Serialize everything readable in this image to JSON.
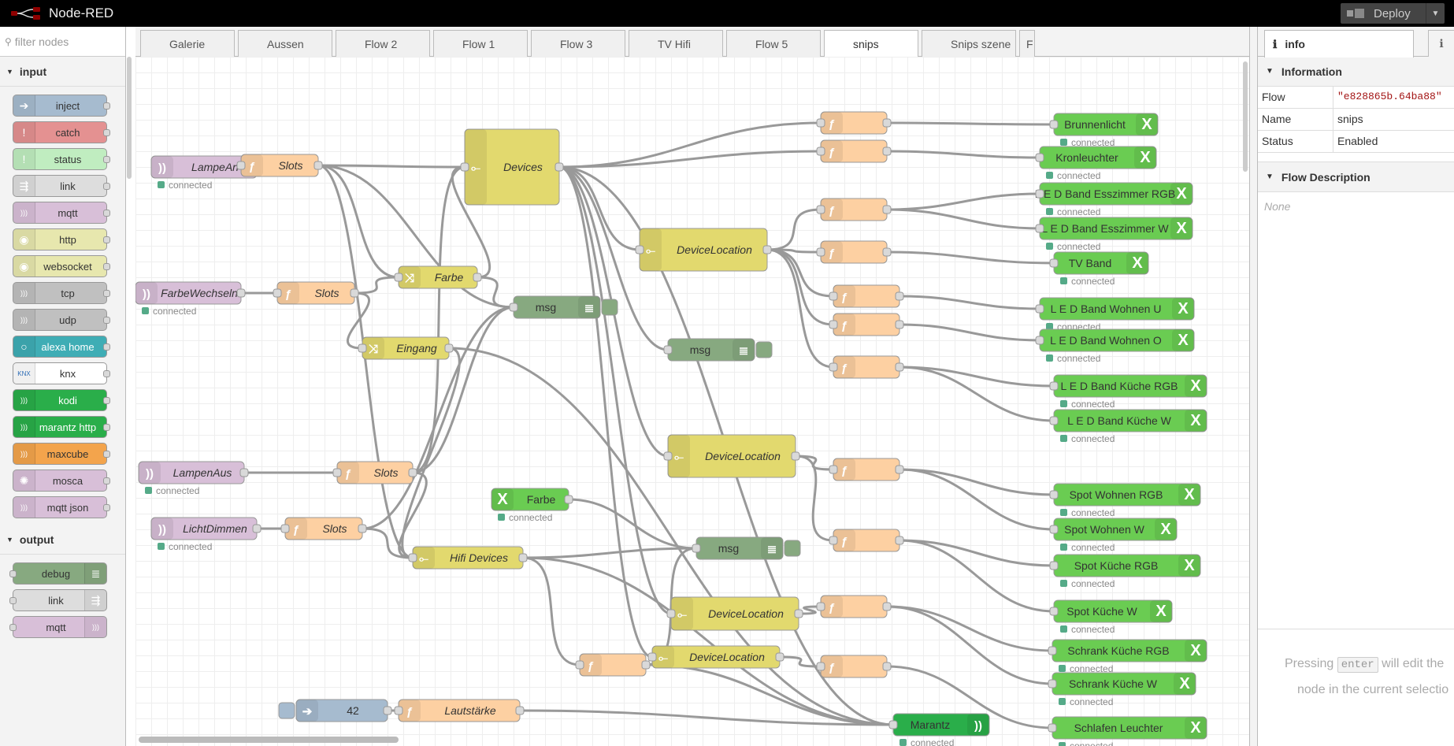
{
  "header": {
    "title": "Node-RED",
    "deploy_label": "Deploy"
  },
  "palette": {
    "search_placeholder": "filter nodes",
    "categories": [
      {
        "label": "input",
        "nodes": [
          {
            "label": "inject",
            "color": "#a6bbcf",
            "icon": "arrow-right-icon"
          },
          {
            "label": "catch",
            "color": "#e49191",
            "icon": "exclamation-icon"
          },
          {
            "label": "status",
            "color": "#c0edc0",
            "icon": "exclamation-icon"
          },
          {
            "label": "link",
            "color": "#dddddd",
            "icon": "link-icon"
          },
          {
            "label": "mqtt",
            "color": "#d8bfd8",
            "icon": "bridge-icon"
          },
          {
            "label": "http",
            "color": "#e7e7ae",
            "icon": "globe-icon"
          },
          {
            "label": "websocket",
            "color": "#e7e7ae",
            "icon": "globe-icon"
          },
          {
            "label": "tcp",
            "color": "#c0c0c0",
            "icon": "bridge-icon"
          },
          {
            "label": "udp",
            "color": "#c0c0c0",
            "icon": "bridge-icon"
          },
          {
            "label": "alexa home",
            "color": "#3fadb5",
            "icon": "alexa-icon"
          },
          {
            "label": "knx",
            "color": "#ffffff",
            "icon": "knx-icon"
          },
          {
            "label": "kodi",
            "color": "#2aae4a",
            "icon": "bridge-icon"
          },
          {
            "label": "marantz http",
            "color": "#2aae4a",
            "icon": "bridge-icon"
          },
          {
            "label": "maxcube",
            "color": "#f3a44c",
            "icon": "bridge-icon"
          },
          {
            "label": "mosca",
            "color": "#d8bfd8",
            "icon": "mosca-icon"
          },
          {
            "label": "mqtt json",
            "color": "#d8bfd8",
            "icon": "bridge-icon"
          }
        ]
      },
      {
        "label": "output",
        "nodes": [
          {
            "label": "debug",
            "color": "#87a980",
            "icon": "list-icon"
          },
          {
            "label": "link",
            "color": "#dddddd",
            "icon": "link-icon"
          },
          {
            "label": "mqtt",
            "color": "#d8bfd8",
            "icon": "bridge-icon"
          }
        ]
      }
    ]
  },
  "tabs": [
    {
      "label": "Galerie"
    },
    {
      "label": "Aussen"
    },
    {
      "label": "Flow 2"
    },
    {
      "label": "Flow 1"
    },
    {
      "label": "Flow 3"
    },
    {
      "label": "TV Hifi"
    },
    {
      "label": "Flow 5"
    },
    {
      "label": "snips",
      "active": true
    },
    {
      "label": "Snips szene"
    },
    {
      "label": "F"
    }
  ],
  "flow": {
    "connected_text": "connected",
    "nodes": [
      {
        "id": "lampean",
        "type": "mqtt-in",
        "label": "LampeAn",
        "status": "connected",
        "italic": true
      },
      {
        "id": "slots1",
        "type": "function",
        "label": "Slots",
        "italic": true
      },
      {
        "id": "devices",
        "type": "switch",
        "label": "Devices",
        "italic": true
      },
      {
        "id": "farbewechseln",
        "type": "mqtt-in",
        "label": "FarbeWechseln",
        "status": "connected",
        "italic": true
      },
      {
        "id": "slots2",
        "type": "function",
        "label": "Slots",
        "italic": true
      },
      {
        "id": "farbe",
        "type": "change",
        "label": "Farbe",
        "italic": true
      },
      {
        "id": "msg1",
        "type": "debug",
        "label": "msg"
      },
      {
        "id": "eingang",
        "type": "change",
        "label": "Eingang",
        "italic": true
      },
      {
        "id": "msg2",
        "type": "debug",
        "label": "msg"
      },
      {
        "id": "devloc1",
        "type": "switch",
        "label": "DeviceLocation",
        "italic": true
      },
      {
        "id": "devloc2",
        "type": "switch",
        "label": "DeviceLocation",
        "italic": true
      },
      {
        "id": "lampenaus",
        "type": "mqtt-in",
        "label": "LampenAus",
        "status": "connected",
        "italic": true
      },
      {
        "id": "slots3",
        "type": "function",
        "label": "Slots",
        "italic": true
      },
      {
        "id": "farbe_in",
        "type": "xmodule-in",
        "label": "Farbe",
        "status": "connected"
      },
      {
        "id": "lichtdimmen",
        "type": "mqtt-in",
        "label": "LichtDimmen",
        "status": "connected",
        "italic": true
      },
      {
        "id": "slots4",
        "type": "function",
        "label": "Slots",
        "italic": true
      },
      {
        "id": "hifi",
        "type": "switch",
        "label": "Hifi Devices",
        "italic": true
      },
      {
        "id": "msg3",
        "type": "debug",
        "label": "msg"
      },
      {
        "id": "devloc3",
        "type": "switch",
        "label": "DeviceLocation",
        "italic": true
      },
      {
        "id": "devloc4",
        "type": "switch",
        "label": "DeviceLocation",
        "italic": true
      },
      {
        "id": "inject42",
        "type": "inject",
        "label": "42"
      },
      {
        "id": "lautstaerke",
        "type": "function",
        "label": "Lautstärke",
        "italic": true
      },
      {
        "id": "marantz",
        "type": "marantz",
        "label": "Marantz",
        "status": "connected"
      },
      {
        "id": "brunnenlicht",
        "type": "xmodule",
        "label": "Brunnenlicht",
        "status": "connected"
      },
      {
        "id": "kronleuchter",
        "type": "xmodule",
        "label": "Kronleuchter",
        "status": "connected"
      },
      {
        "id": "ledezrgb",
        "type": "xmodule",
        "label": "L E D Band Esszimmer RGB",
        "status": "connected"
      },
      {
        "id": "ledezw",
        "type": "xmodule",
        "label": "L E D Band Esszimmer W",
        "status": "connected"
      },
      {
        "id": "tvband",
        "type": "xmodule",
        "label": "TV Band",
        "status": "connected"
      },
      {
        "id": "ledwu",
        "type": "xmodule",
        "label": "L E D Band Wohnen U",
        "status": "connected"
      },
      {
        "id": "ledwo",
        "type": "xmodule",
        "label": "L E D Band Wohnen O",
        "status": "connected"
      },
      {
        "id": "ledkrgb",
        "type": "xmodule",
        "label": "L E D Band Küche RGB",
        "status": "connected"
      },
      {
        "id": "ledkw",
        "type": "xmodule",
        "label": "L E D Band Küche W",
        "status": "connected"
      },
      {
        "id": "spotwrgb",
        "type": "xmodule",
        "label": "Spot Wohnen RGB",
        "status": "connected"
      },
      {
        "id": "spotww",
        "type": "xmodule",
        "label": "Spot Wohnen W",
        "status": "connected"
      },
      {
        "id": "spotkrgb",
        "type": "xmodule",
        "label": "Spot Küche RGB",
        "status": "connected"
      },
      {
        "id": "spotkw",
        "type": "xmodule",
        "label": "Spot Küche W",
        "status": "connected"
      },
      {
        "id": "schrankkrgb",
        "type": "xmodule",
        "label": "Schrank Küche RGB",
        "status": "connected"
      },
      {
        "id": "schrankkw",
        "type": "xmodule",
        "label": "Schrank Küche W",
        "status": "connected"
      },
      {
        "id": "schlafen",
        "type": "xmodule",
        "label": "Schlafen Leuchter",
        "status": "connected"
      }
    ]
  },
  "sidebar": {
    "tab_label": "info",
    "info_section": "Information",
    "rows": [
      {
        "key": "Flow",
        "value": "\"e828865b.64ba88\""
      },
      {
        "key": "Name",
        "value": "snips"
      },
      {
        "key": "Status",
        "value": "Enabled"
      }
    ],
    "description_section": "Flow Description",
    "description": "None",
    "hint_pre": "Pressing",
    "hint_key": "enter",
    "hint_post": "will edit the",
    "hint_line2": "node in the current selectio"
  }
}
